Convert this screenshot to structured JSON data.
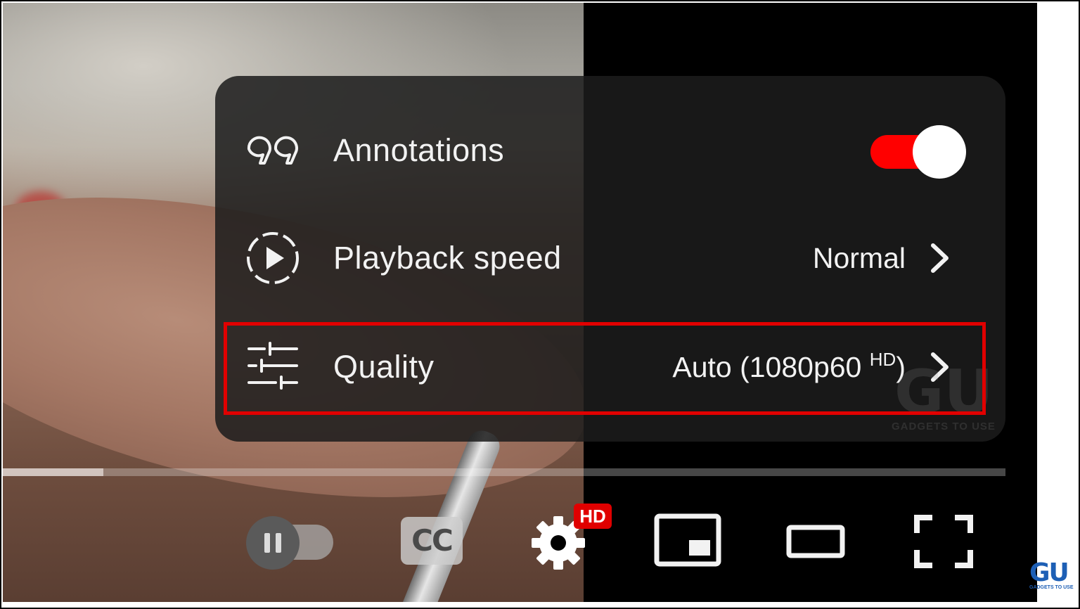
{
  "settings_menu": {
    "annotations": {
      "label": "Annotations",
      "icon": "annotations-quote-icon",
      "toggle_on": true,
      "toggle_color": "#ff0000"
    },
    "playback_speed": {
      "label": "Playback speed",
      "value": "Normal",
      "icon": "playback-speed-icon"
    },
    "quality": {
      "label": "Quality",
      "value": "Auto (1080p60",
      "value_sup": "HD",
      "value_close": ")",
      "icon": "quality-sliders-icon",
      "highlighted": true,
      "highlight_color": "#e10000"
    }
  },
  "progress": {
    "loaded_fraction": 0.1
  },
  "controls": {
    "autoplay": {
      "state": "off",
      "icon": "pause-icon"
    },
    "captions": {
      "label": "CC"
    },
    "settings": {
      "icon": "gear-icon",
      "badge": "HD",
      "badge_color": "#e00000"
    },
    "miniplayer": {
      "icon": "miniplayer-icon"
    },
    "theater": {
      "icon": "theater-mode-icon"
    },
    "fullscreen": {
      "icon": "fullscreen-icon"
    }
  },
  "watermark": {
    "logo_text": "GU",
    "caption": "GADGETS TO USE"
  }
}
